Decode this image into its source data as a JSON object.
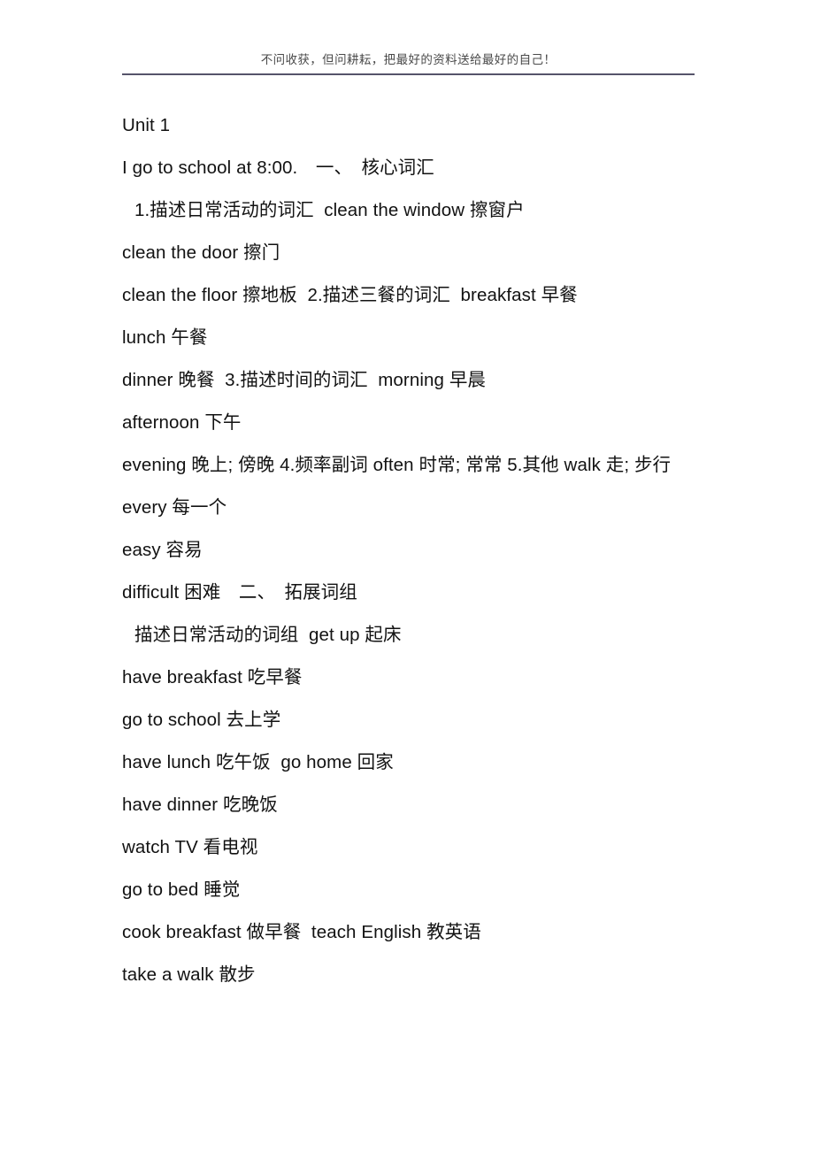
{
  "header": {
    "text": "不问收获，但问耕耘，把最好的资料送给最好的自己！",
    "rule_color": "#55546a"
  },
  "document": {
    "title": "Unit 1",
    "lines": [
      {
        "id": "unit-heading",
        "text": "Unit 1",
        "indent": false
      },
      {
        "id": "lesson-title",
        "text": "I go to school at 8:00.　一、　核心词汇",
        "indent": false
      },
      {
        "id": "vocab-group-1",
        "text": "1.描述日常活动的词汇  clean the window 擦窗户",
        "indent": true
      },
      {
        "id": "clean-the-door",
        "text": "clean the door 擦门",
        "indent": false
      },
      {
        "id": "clean-the-floor",
        "text": "clean the floor 擦地板  2.描述三餐的词汇  breakfast 早餐",
        "indent": false
      },
      {
        "id": "lunch",
        "text": "lunch 午餐",
        "indent": false
      },
      {
        "id": "dinner",
        "text": "dinner 晚餐  3.描述时间的词汇  morning 早晨",
        "indent": false
      },
      {
        "id": "afternoon",
        "text": "afternoon 下午",
        "indent": false
      },
      {
        "id": "evening-adverbs",
        "text": "evening 晚上; 傍晚  4.频率副词  often 时常; 常常  5.其他  walk 走; 步行",
        "indent": false,
        "wraps": true
      },
      {
        "id": "every",
        "text": "every 每一个",
        "indent": false
      },
      {
        "id": "easy",
        "text": "easy 容易",
        "indent": false
      },
      {
        "id": "difficult-section-2",
        "text": "difficult 困难　二、　拓展词组",
        "indent": false
      },
      {
        "id": "phrase-group-1",
        "text": "描述日常活动的词组  get up 起床",
        "indent": true
      },
      {
        "id": "have-breakfast",
        "text": "have breakfast 吃早餐",
        "indent": false
      },
      {
        "id": "go-to-school",
        "text": "go to school 去上学",
        "indent": false
      },
      {
        "id": "have-lunch-go-home",
        "text": "have lunch 吃午饭  go home 回家",
        "indent": false
      },
      {
        "id": "have-dinner",
        "text": "have dinner 吃晚饭",
        "indent": false
      },
      {
        "id": "watch-tv",
        "text": "watch TV 看电视",
        "indent": false
      },
      {
        "id": "go-to-bed",
        "text": "go to bed 睡觉",
        "indent": false
      },
      {
        "id": "cook-teach",
        "text": "cook breakfast 做早餐  teach English 教英语",
        "indent": false
      },
      {
        "id": "take-a-walk",
        "text": "take a walk 散步",
        "indent": false
      }
    ]
  }
}
